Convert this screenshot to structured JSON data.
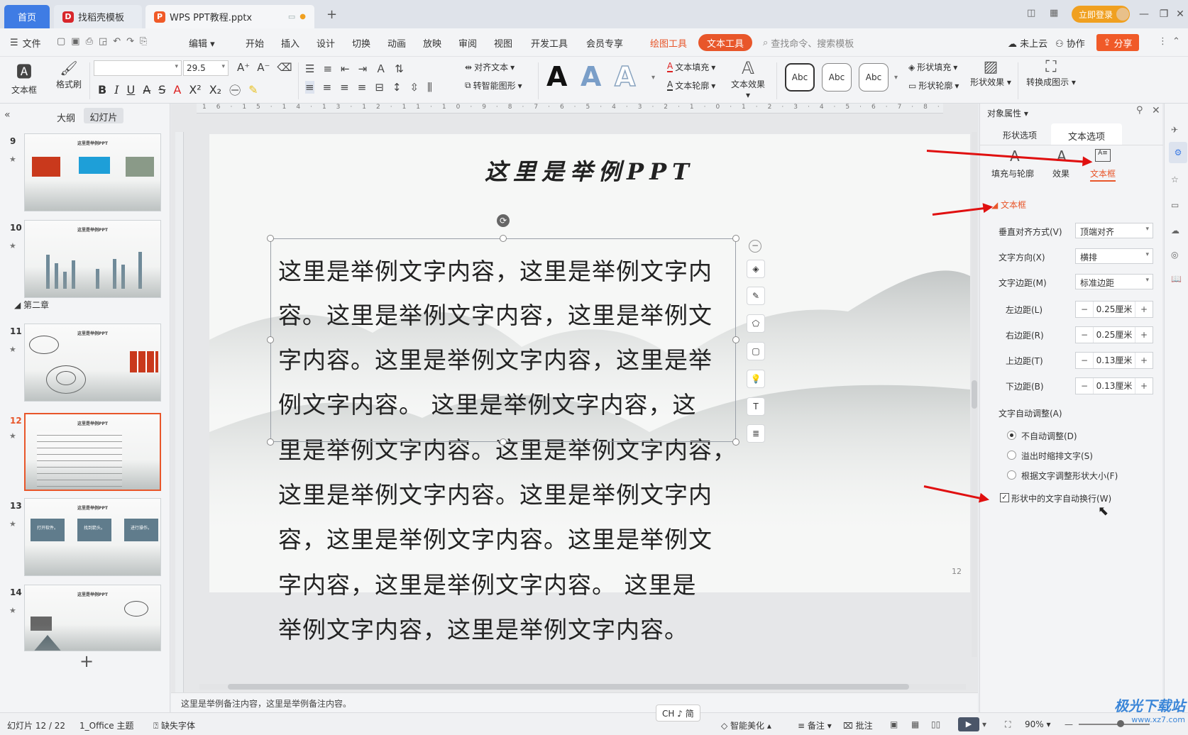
{
  "tabs": {
    "home": "首页",
    "template": "找稻壳模板",
    "document": "WPS PPT教程.pptx",
    "login": "立即登录"
  },
  "menu": {
    "file": "文件",
    "edit": "编辑",
    "items": [
      "开始",
      "插入",
      "设计",
      "切换",
      "动画",
      "放映",
      "审阅",
      "视图",
      "开发工具",
      "会员专享"
    ],
    "draw_tools": "绘图工具",
    "text_tools": "文本工具",
    "search_placeholder": "查找命令、搜索模板",
    "cloud": "未上云",
    "collab": "协作",
    "share": "分享"
  },
  "ribbon": {
    "textbox": "文本框",
    "format_painter": "格式刷",
    "font_size": "29.5",
    "align_text": "对齐文本",
    "smart_graphic": "转智能图形",
    "text_fill": "文本填充",
    "text_outline": "文本轮廓",
    "text_effect": "文本效果",
    "abc": "Abc",
    "shape_fill": "形状填充",
    "shape_outline": "形状轮廓",
    "shape_effect": "形状效果",
    "convert_graphic": "转换成图示"
  },
  "left_panel": {
    "outline_tab": "大纲",
    "slides_tab": "幻灯片",
    "section": "第二章",
    "slides": [
      {
        "num": "9",
        "title": "这里是举例PPT"
      },
      {
        "num": "10",
        "title": "这里是举例PPT"
      },
      {
        "num": "11",
        "title": "这里是举例PPT"
      },
      {
        "num": "12",
        "title": "这里是举例PPT"
      },
      {
        "num": "13",
        "title": "这里是举例PPT"
      },
      {
        "num": "14",
        "title": "这里是举例PPT"
      }
    ],
    "thumb13_boxes": [
      "打开软件。",
      "找到箭头。",
      "进行操作。"
    ]
  },
  "slide": {
    "title": "这里是举例PPT",
    "lines": [
      "这里是举例文字内容，这里是举例文字内",
      "容。这里是举例文字内容，这里是举例文",
      "字内容。这里是举例文字内容，这里是举",
      "例文字内容。 这里是举例文字内容，这",
      "里是举例文字内容。这里是举例文字内容，",
      "这里是举例文字内容。这里是举例文字内",
      "容，这里是举例文字内容。这里是举例文",
      "字内容，这里是举例文字内容。 这里是",
      "举例文字内容，这里是举例文字内容。"
    ],
    "page_number": "12"
  },
  "notes": "这里是举例备注内容，这里是举例备注内容。",
  "right_panel": {
    "header": "对象属性",
    "tab_shape": "形状选项",
    "tab_text": "文本选项",
    "sub_fill": "填充与轮廓",
    "sub_effect": "效果",
    "sub_textbox": "文本框",
    "section": "文本框",
    "valign_label": "垂直对齐方式(V)",
    "valign_value": "顶端对齐",
    "dir_label": "文字方向(X)",
    "dir_value": "横排",
    "margin_label": "文字边距(M)",
    "margin_value": "标准边距",
    "left_label": "左边距(L)",
    "left_value": "0.25厘米",
    "right_label": "右边距(R)",
    "right_value": "0.25厘米",
    "top_label": "上边距(T)",
    "top_value": "0.13厘米",
    "bottom_label": "下边距(B)",
    "bottom_value": "0.13厘米",
    "autofit_label": "文字自动调整(A)",
    "opt1": "不自动调整(D)",
    "opt2": "溢出时缩排文字(S)",
    "opt3": "根据文字调整形状大小(F)",
    "wrap": "形状中的文字自动换行(W)"
  },
  "status": {
    "slide_count": "幻灯片 12 / 22",
    "theme": "1_Office 主题",
    "missing_font": "缺失字体",
    "ime": "CH ♪ 简",
    "beautify": "智能美化",
    "notes": "备注",
    "comment": "批注",
    "zoom": "90%",
    "watermark": "极光下载站",
    "watermark_url": "www.xz7.com"
  },
  "colors": {
    "accent_blue": "#3f7ce4",
    "wps_orange": "#f05a28",
    "text_tool_red": "#e8562a",
    "arrow_red": "#e01010"
  }
}
